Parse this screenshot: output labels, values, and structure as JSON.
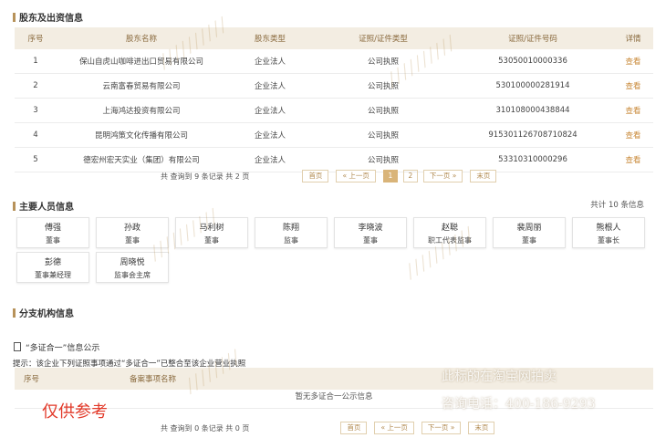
{
  "shareholders": {
    "title": "股东及出资信息",
    "headers": [
      "序号",
      "股东名称",
      "股东类型",
      "证照/证件类型",
      "证照/证件号码",
      "详情"
    ],
    "rows": [
      {
        "no": "1",
        "name": "保山自虎山咖啡进出口贸易有限公司",
        "type": "企业法人",
        "cert": "公司执照",
        "num": "53050010000336",
        "link": "查看"
      },
      {
        "no": "2",
        "name": "云南富春贸易有限公司",
        "type": "企业法人",
        "cert": "公司执照",
        "num": "530100000281914",
        "link": "查看"
      },
      {
        "no": "3",
        "name": "上海鸿达投资有限公司",
        "type": "企业法人",
        "cert": "公司执照",
        "num": "310108000438844",
        "link": "查看"
      },
      {
        "no": "4",
        "name": "昆明鸿策文化传播有限公司",
        "type": "企业法人",
        "cert": "公司执照",
        "num": "915301126708710824",
        "link": "查看"
      },
      {
        "no": "5",
        "name": "德宏州宏天实业（集团）有限公司",
        "type": "企业法人",
        "cert": "公司执照",
        "num": "53310310000296",
        "link": "查看"
      }
    ],
    "pager": {
      "info": "共 查询到 9 条记录 共 2 页",
      "first": "首页",
      "prev": "« 上一页",
      "pages": [
        "1",
        "2"
      ],
      "next": "下一页 »",
      "last": "末页"
    }
  },
  "personnel": {
    "title": "主要人员信息",
    "count": "共计 10 条信息",
    "people": [
      {
        "name": "傅强",
        "role": "董事"
      },
      {
        "name": "孙政",
        "role": "董事"
      },
      {
        "name": "马利树",
        "role": "董事"
      },
      {
        "name": "陈翔",
        "role": "监事"
      },
      {
        "name": "李晓波",
        "role": "董事"
      },
      {
        "name": "赵聪",
        "role": "职工代表监事"
      },
      {
        "name": "裴周丽",
        "role": "董事"
      },
      {
        "name": "熊根人",
        "role": "董事长"
      },
      {
        "name": "彭德",
        "role": "董事兼经理"
      },
      {
        "name": "周晓悦",
        "role": "监事会主席"
      }
    ]
  },
  "branches": {
    "title": "分支机构信息"
  },
  "multi": {
    "title": "“多证合一”信息公示",
    "notice": "提示：该企业下列证照事项通过“多证合一”已整合至该企业营业执照",
    "headers": [
      "序号",
      "备案事项名称"
    ],
    "empty": "暂无多证合一公示信息",
    "pager": {
      "info": "共 查询到 0 条记录 共 0 页",
      "first": "首页",
      "prev": "« 上一页",
      "next": "下一页 »",
      "last": "末页"
    }
  },
  "overlay": {
    "reference": "仅供参考",
    "sale": "此标的在淘宝网拍卖",
    "phone": "咨询电话：400-186-9293"
  },
  "colors": {
    "accent": "#b7925a",
    "header_bg": "#f3ede2",
    "link": "#c98a3a",
    "stamp": "#e23a2a"
  }
}
